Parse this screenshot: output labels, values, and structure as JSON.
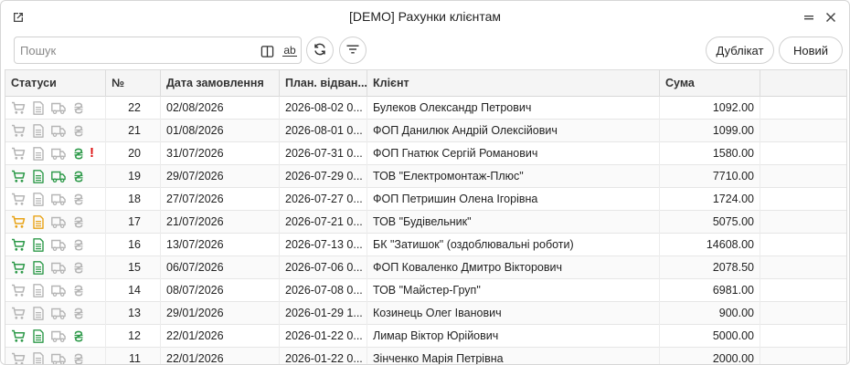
{
  "window": {
    "title": "[DEMO] Рахунки клієнтам",
    "icons": {
      "popout": "external-link-icon",
      "minimize": "minimize-icon",
      "close": "close-icon"
    }
  },
  "toolbar": {
    "search_placeholder": "Пошук",
    "search_value": "",
    "ab_label": "ab",
    "duplicate_label": "Дублікат",
    "new_label": "Новий",
    "icons": {
      "layout": "columns-icon",
      "match": "match-case-icon",
      "refresh": "refresh-icon",
      "filter": "filter-icon"
    }
  },
  "colors": {
    "active": "#2e9a4a",
    "pending": "#e8a317",
    "inactive": "#b5b5b5",
    "alert": "#dd1111"
  },
  "table": {
    "columns": [
      "Статуси",
      "№",
      "Дата замовлення",
      "План. відван...",
      "Клієнт",
      "Сума"
    ],
    "rows": [
      {
        "status": {
          "cart": "inactive",
          "doc": "inactive",
          "truck": "inactive",
          "money": "inactive",
          "alert": ""
        },
        "num": "22",
        "date": "02/08/2026",
        "plan": "2026-08-02 0...",
        "client": "Булеков Олександр Петрович",
        "sum": "1092.00"
      },
      {
        "status": {
          "cart": "inactive",
          "doc": "inactive",
          "truck": "inactive",
          "money": "inactive",
          "alert": ""
        },
        "num": "21",
        "date": "01/08/2026",
        "plan": "2026-08-01 0...",
        "client": "ФОП Данилюк Андрій Олексійович",
        "sum": "1099.00"
      },
      {
        "status": {
          "cart": "inactive",
          "doc": "inactive",
          "truck": "inactive",
          "money": "active",
          "alert": "!"
        },
        "num": "20",
        "date": "31/07/2026",
        "plan": "2026-07-31 0...",
        "client": "ФОП Гнатюк Сергій Романович",
        "sum": "1580.00"
      },
      {
        "status": {
          "cart": "active",
          "doc": "active",
          "truck": "active",
          "money": "active",
          "alert": ""
        },
        "num": "19",
        "date": "29/07/2026",
        "plan": "2026-07-29 0...",
        "client": "ТОВ \"Електромонтаж-Плюс\"",
        "sum": "7710.00"
      },
      {
        "status": {
          "cart": "inactive",
          "doc": "inactive",
          "truck": "inactive",
          "money": "inactive",
          "alert": ""
        },
        "num": "18",
        "date": "27/07/2026",
        "plan": "2026-07-27 0...",
        "client": "ФОП Петришин Олена Ігорівна",
        "sum": "1724.00"
      },
      {
        "status": {
          "cart": "pending",
          "doc": "pending",
          "truck": "inactive",
          "money": "inactive",
          "alert": ""
        },
        "num": "17",
        "date": "21/07/2026",
        "plan": "2026-07-21 0...",
        "client": "ТОВ \"Будівельник\"",
        "sum": "5075.00"
      },
      {
        "status": {
          "cart": "active",
          "doc": "active",
          "truck": "inactive",
          "money": "inactive",
          "alert": ""
        },
        "num": "16",
        "date": "13/07/2026",
        "plan": "2026-07-13 0...",
        "client": "БК \"Затишок\" (оздоблювальні роботи)",
        "sum": "14608.00"
      },
      {
        "status": {
          "cart": "active",
          "doc": "active",
          "truck": "inactive",
          "money": "inactive",
          "alert": ""
        },
        "num": "15",
        "date": "06/07/2026",
        "plan": "2026-07-06 0...",
        "client": "ФОП Коваленко Дмитро Вікторович",
        "sum": "2078.50"
      },
      {
        "status": {
          "cart": "inactive",
          "doc": "inactive",
          "truck": "inactive",
          "money": "inactive",
          "alert": ""
        },
        "num": "14",
        "date": "08/07/2026",
        "plan": "2026-07-08 0...",
        "client": "ТОВ \"Майстер-Груп\"",
        "sum": "6981.00"
      },
      {
        "status": {
          "cart": "inactive",
          "doc": "inactive",
          "truck": "inactive",
          "money": "inactive",
          "alert": ""
        },
        "num": "13",
        "date": "29/01/2026",
        "plan": "2026-01-29 1...",
        "client": "Козинець Олег Іванович",
        "sum": "900.00"
      },
      {
        "status": {
          "cart": "active",
          "doc": "active",
          "truck": "inactive",
          "money": "active",
          "alert": ""
        },
        "num": "12",
        "date": "22/01/2026",
        "plan": "2026-01-22 0...",
        "client": "Лимар Віктор Юрійович",
        "sum": "5000.00"
      },
      {
        "status": {
          "cart": "inactive",
          "doc": "inactive",
          "truck": "inactive",
          "money": "inactive",
          "alert": ""
        },
        "num": "11",
        "date": "22/01/2026",
        "plan": "2026-01-22 0...",
        "client": "Зінченко Марія Петрівна",
        "sum": "2000.00"
      }
    ]
  }
}
